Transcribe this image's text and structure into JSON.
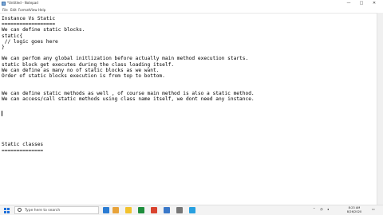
{
  "window": {
    "title": "*Untitled - Notepad",
    "minimize": "—",
    "maximize": "□",
    "close": "✕"
  },
  "menu": [
    "File",
    "Edit",
    "Format",
    "View",
    "Help"
  ],
  "editor": {
    "lines": [
      "Instance Vs Static",
      "==================",
      "We can define static blocks.",
      "static{",
      " // logic goes here",
      "}",
      "",
      "We can perfom any global initlization before actually main method execution starts.",
      "static block get executes during the class loading itself.",
      "We can define as many no of static blocks as we want.",
      "Order of static blocks execution is from top to bottom.",
      "",
      "",
      "We can define static methods as well , of course main method is also a static method.",
      "We can access/call static methods using class name itself, we dont need any instance.",
      "",
      "",
      "",
      "",
      "",
      "",
      "",
      "Static classes",
      "=============="
    ]
  },
  "taskbar": {
    "search_placeholder": "Type here to search",
    "clock_time": "8:23 AM",
    "clock_date": "8/26/2020",
    "app_colors": [
      "#2b7cd3",
      "#e8a33a",
      "#f2c22e",
      "#1f8e3d",
      "#d9432f",
      "#3a78c9",
      "#777777",
      "#28a0e0"
    ]
  }
}
